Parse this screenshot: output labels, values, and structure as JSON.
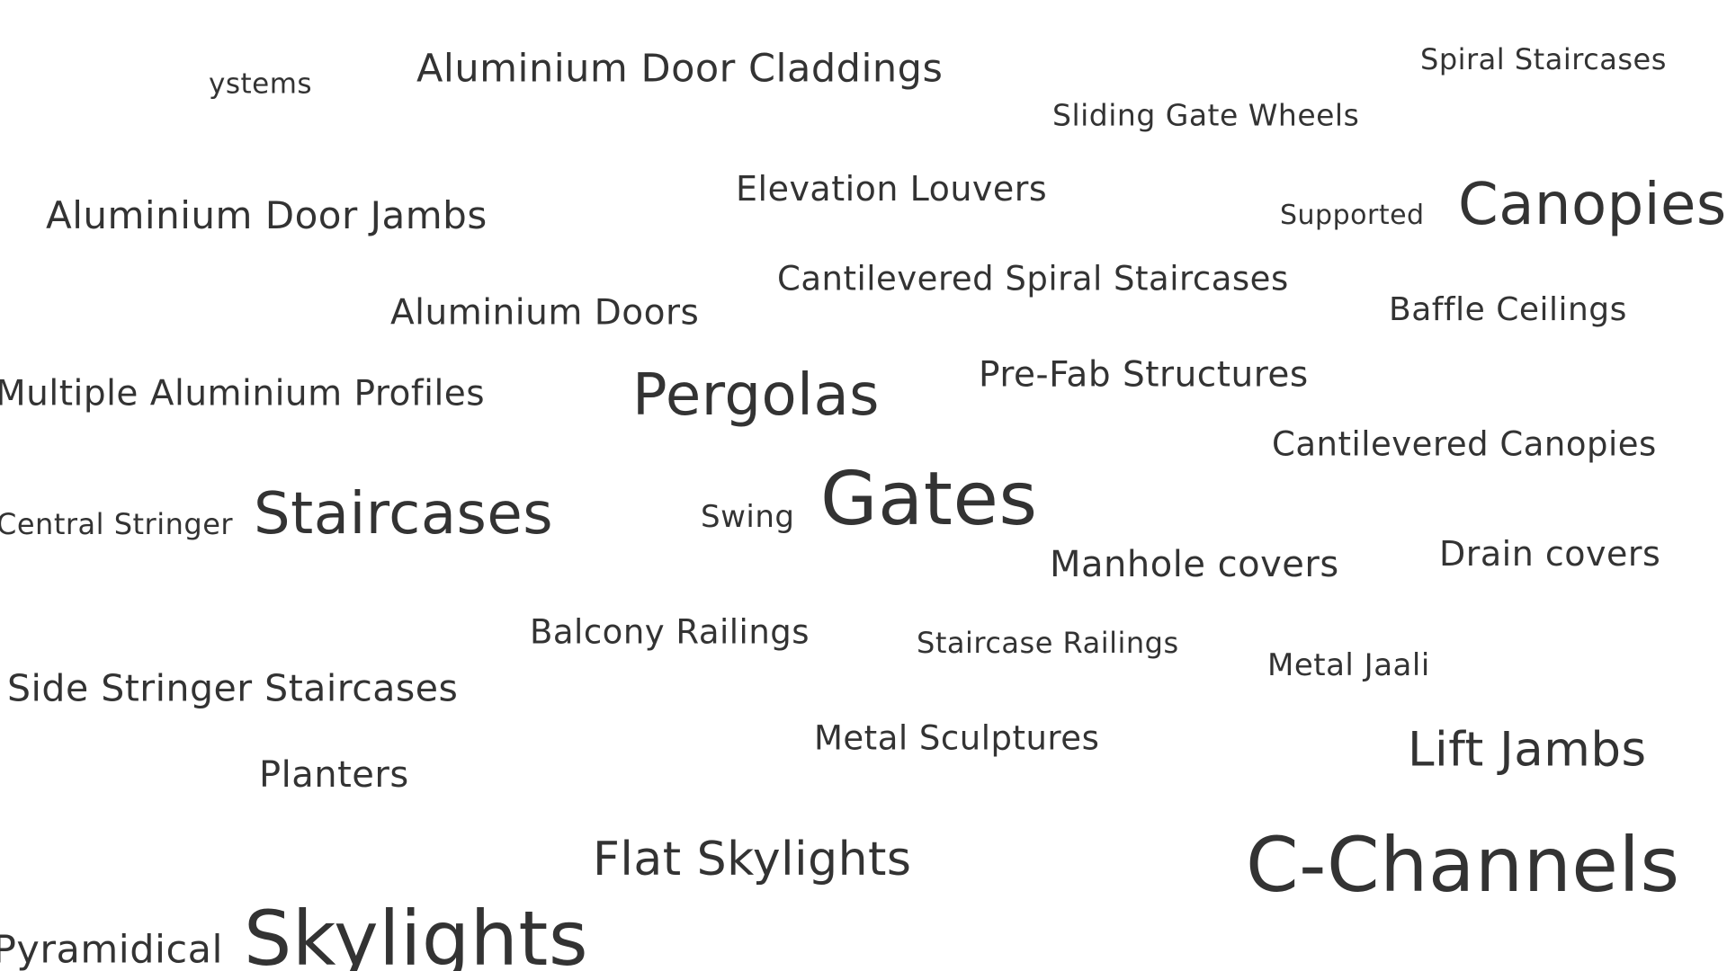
{
  "cloud": {
    "terms": [
      "ystems",
      "Aluminium Door Claddings",
      "Spiral Staircases",
      "Sliding Gate Wheels",
      "Elevation Louvers",
      "Aluminium Door Jambs",
      "Supported",
      "Canopies",
      "Cantilevered Spiral Staircases",
      "Baffle Ceilings",
      "Aluminium Doors",
      "Pre-Fab Structures",
      "Multiple Aluminium Profiles",
      "Pergolas",
      "Cantilevered Canopies",
      "Central Stringer",
      "Staircases",
      "Swing",
      "Gates",
      "Manhole covers",
      "Drain covers",
      "Balcony Railings",
      "Staircase Railings",
      "Metal Jaali",
      "Side Stringer Staircases",
      "Metal Sculptures",
      "Lift Jambs",
      "Planters",
      "Flat Skylights",
      "C-Channels",
      "Pyramidical",
      "Skylights"
    ],
    "text_color": "#333333",
    "background_color": "#ffffff"
  }
}
